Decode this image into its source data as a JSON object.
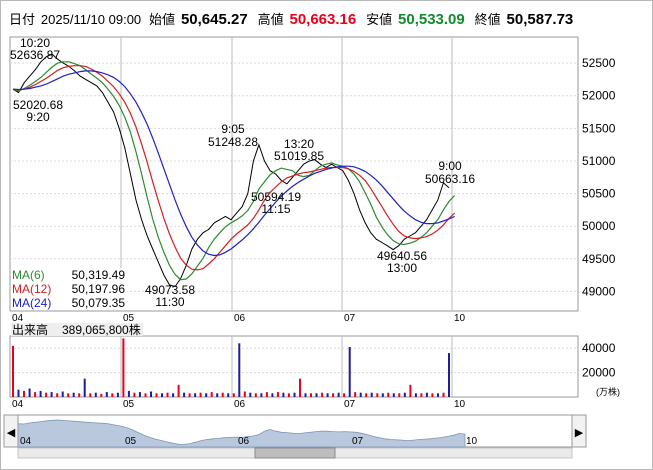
{
  "header": {
    "date_label": "日付",
    "datetime": "2025/11/10 09:00",
    "open_label": "始値",
    "open": "50,645.27",
    "high_label": "高値",
    "high": "50,663.16",
    "low_label": "安値",
    "low": "50,533.09",
    "close_label": "終値",
    "close": "50,587.73"
  },
  "colors": {
    "high": "#e8001c",
    "low": "#118b2e",
    "ma6": "#2f8a2f",
    "ma12": "#d42020",
    "ma24": "#2020c8",
    "price": "#000000",
    "vol_up": "#e8001c",
    "vol_down": "#1c1c9c",
    "nav_fill": "#b9c8dc"
  },
  "chart_data": [
    {
      "type": "line",
      "title": "",
      "xlabel": "",
      "ylabel": "",
      "x_ticks": [
        "04",
        "05",
        "06",
        "07",
        "10"
      ],
      "ylim": [
        48700,
        52900
      ],
      "y_ticks": [
        49000,
        49500,
        50000,
        50500,
        51000,
        51500,
        52000,
        52500
      ],
      "y_tick_labels": [
        "49000",
        "49500",
        "50000",
        "50500",
        "51000",
        "51500",
        "52000",
        "52500"
      ],
      "grid": true,
      "series": [
        {
          "name": "price",
          "values": [
            52100,
            52050,
            52200,
            52300,
            52400,
            52520,
            52600,
            52636.87,
            52560,
            52500,
            52450,
            52380,
            52300,
            52250,
            52200,
            52150,
            52050,
            51900,
            51750,
            51500,
            51200,
            50800,
            50400,
            50100,
            49850,
            49650,
            49450,
            49250,
            49100,
            49073.58,
            49200,
            49400,
            49650,
            49800,
            49900,
            49950,
            50050,
            50100,
            50150,
            50100,
            50200,
            50300,
            50500,
            51000,
            51248.28,
            51000,
            50850,
            50800,
            50700,
            50650,
            50750,
            50850,
            50950,
            51000,
            51019.85,
            50950,
            50900,
            50950,
            50900,
            50850,
            50700,
            50500,
            50250,
            50050,
            49900,
            49800,
            49750,
            49700,
            49640.56,
            49700,
            49800,
            49850,
            49900,
            50000,
            50100,
            50250,
            50400,
            50663.16,
            50587.73
          ]
        },
        {
          "name": "MA(6)",
          "values": [
            52100,
            52070,
            52110,
            52160,
            52220,
            52280,
            52360,
            52440,
            52500,
            52520,
            52520,
            52490,
            52460,
            52400,
            52330,
            52270,
            52200,
            52100,
            51990,
            51850,
            51670,
            51440,
            51140,
            50800,
            50440,
            50110,
            49830,
            49600,
            49400,
            49260,
            49180,
            49190,
            49270,
            49390,
            49510,
            49670,
            49800,
            49900,
            49990,
            50050,
            50100,
            50160,
            50240,
            50380,
            50570,
            50680,
            50790,
            50850,
            50890,
            50870,
            50850,
            50780,
            50760,
            50780,
            50850,
            50920,
            50950,
            50970,
            50940,
            50920,
            50880,
            50800,
            50680,
            50510,
            50340,
            50140,
            49990,
            49870,
            49780,
            49730,
            49720,
            49740,
            49770,
            49830,
            49900,
            50000,
            50100,
            50250,
            50380,
            50470
          ]
        },
        {
          "name": "MA(12)",
          "values": [
            52100,
            52090,
            52100,
            52130,
            52170,
            52220,
            52270,
            52330,
            52390,
            52430,
            52450,
            52460,
            52460,
            52450,
            52410,
            52360,
            52300,
            52220,
            52140,
            52030,
            51900,
            51730,
            51520,
            51260,
            50980,
            50680,
            50390,
            50120,
            49880,
            49680,
            49510,
            49400,
            49340,
            49330,
            49350,
            49420,
            49500,
            49600,
            49700,
            49800,
            49880,
            49950,
            50020,
            50120,
            50250,
            50400,
            50520,
            50600,
            50680,
            50740,
            50770,
            50800,
            50820,
            50830,
            50850,
            50870,
            50890,
            50900,
            50900,
            50900,
            50880,
            50840,
            50780,
            50700,
            50580,
            50440,
            50300,
            50160,
            50030,
            49920,
            49850,
            49820,
            49810,
            49820,
            49840,
            49880,
            49940,
            50020,
            50120,
            50200
          ]
        },
        {
          "name": "MA(24)",
          "values": [
            52100,
            52095,
            52100,
            52110,
            52130,
            52150,
            52180,
            52220,
            52260,
            52300,
            52330,
            52350,
            52370,
            52380,
            52380,
            52370,
            52350,
            52320,
            52280,
            52220,
            52140,
            52030,
            51900,
            51740,
            51560,
            51350,
            51120,
            50880,
            50640,
            50400,
            50180,
            49990,
            49830,
            49710,
            49620,
            49570,
            49550,
            49560,
            49600,
            49650,
            49720,
            49790,
            49870,
            49960,
            50060,
            50170,
            50270,
            50370,
            50460,
            50540,
            50610,
            50670,
            50720,
            50770,
            50810,
            50840,
            50870,
            50890,
            50910,
            50920,
            50920,
            50910,
            50880,
            50840,
            50780,
            50710,
            50620,
            50520,
            50420,
            50320,
            50230,
            50160,
            50100,
            50060,
            50040,
            50040,
            50050,
            50080,
            50110,
            50150
          ]
        }
      ],
      "annotations": [
        {
          "time": "10:20",
          "price": "52636.87"
        },
        {
          "time": "9:20",
          "price": "52020.68"
        },
        {
          "time": "9:05",
          "price": "51248.28"
        },
        {
          "time": "13:20",
          "price": "51019.85"
        },
        {
          "time": "11:15",
          "price": "50594.19"
        },
        {
          "time": "11:30",
          "price": "49073.58"
        },
        {
          "time": "13:00",
          "price": "49640.56"
        },
        {
          "time": "9:00",
          "price": "50663.16"
        }
      ],
      "legend": [
        {
          "label": "MA(6)",
          "value": "50,319.49"
        },
        {
          "label": "MA(12)",
          "value": "50,197.96"
        },
        {
          "label": "MA(24)",
          "value": "50,079.35"
        }
      ]
    },
    {
      "type": "bar",
      "title": "出来高",
      "total": "389,065,800株",
      "ylim": [
        0,
        50000
      ],
      "y_ticks": [
        20000,
        40000
      ],
      "y_tick_labels": [
        "20000",
        "40000"
      ],
      "unit": "(万株)",
      "x_ticks": [
        "04",
        "05",
        "06",
        "07",
        "10"
      ],
      "values": [
        42000,
        6000,
        5000,
        7000,
        4000,
        5000,
        3500,
        4000,
        3000,
        4500,
        3000,
        3500,
        3000,
        15000,
        3000,
        3500,
        2500,
        4000,
        3000,
        3500,
        48000,
        5000,
        3500,
        4000,
        3000,
        4500,
        3000,
        3000,
        3500,
        3000,
        10000,
        3500,
        3000,
        3000,
        3500,
        3000,
        4000,
        3000,
        3500,
        3000,
        3000,
        44000,
        4500,
        3500,
        3000,
        3000,
        4000,
        3000,
        4000,
        3500,
        3000,
        3500,
        15000,
        3000,
        3000,
        3000,
        3500,
        3000,
        3000,
        3500,
        3000,
        41000,
        4000,
        3500,
        3000,
        3500,
        3000,
        3000,
        3500,
        3000,
        3000,
        3500,
        10000,
        3000,
        3000,
        3500,
        3000,
        3000,
        3500,
        36000
      ]
    }
  ],
  "navigator": {
    "x_ticks": [
      "04",
      "05",
      "06",
      "07",
      "10"
    ],
    "left_arrow": "◀",
    "right_arrow": "▶"
  }
}
